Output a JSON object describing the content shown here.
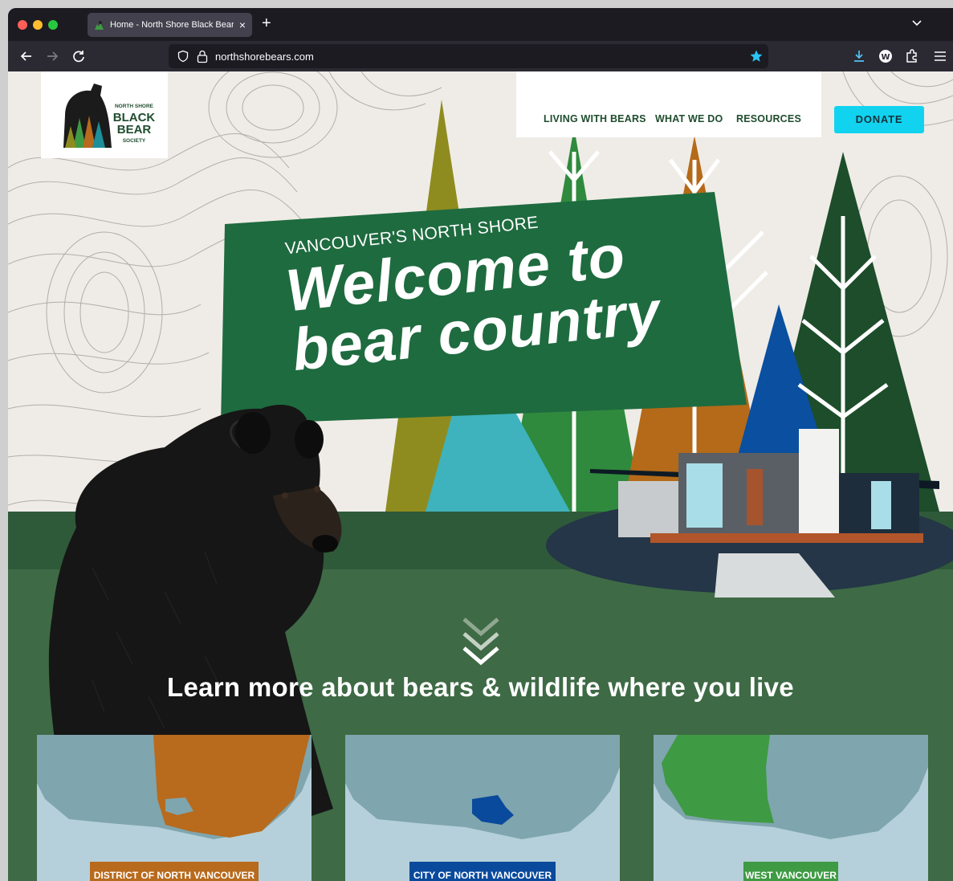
{
  "browser": {
    "tab_title": "Home - North Shore Black Bear",
    "new_tab_label": "+",
    "tab_close_label": "×",
    "url": "northshorebears.com"
  },
  "site": {
    "logo_text": [
      "NORTH SHORE",
      "BLACK",
      "BEAR",
      "SOCIETY"
    ],
    "menu": {
      "living": "LIVING WITH BEARS",
      "what": "WHAT WE DO",
      "resources": "RESOURCES"
    },
    "donate_label": "DONATE"
  },
  "hero": {
    "kicker": "VANCOUVER'S NORTH SHORE",
    "headline_line1": "Welcome to",
    "headline_line2": "bear country"
  },
  "learn_heading": "Learn more about bears & wildlife where you live",
  "cards": [
    {
      "label": "DISTRICT OF NORTH VANCOUVER",
      "color": "#b86a1d"
    },
    {
      "label": "CITY OF NORTH VANCOUVER",
      "color": "#0a4a9c"
    },
    {
      "label": "WEST VANCOUVER",
      "color": "#3e9a43"
    }
  ],
  "colors": {
    "accent_donate": "#11d3ef",
    "forest_green": "#1f6b3f",
    "grass_green": "#3d6a45"
  }
}
